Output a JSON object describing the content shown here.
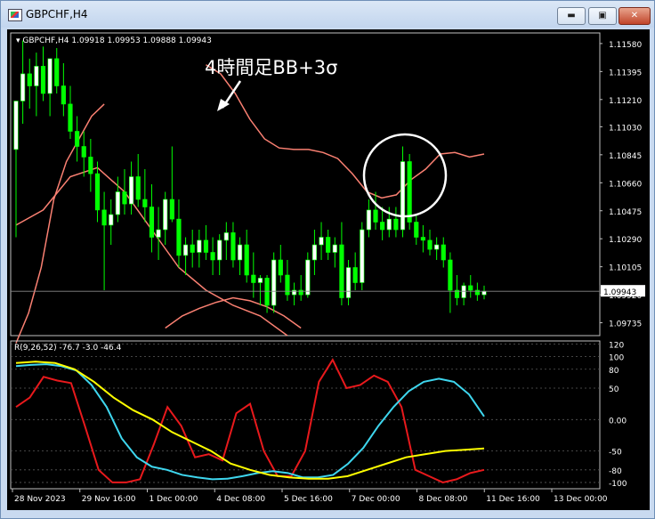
{
  "window": {
    "title": "GBPCHF,H4",
    "buttons": {
      "minimize": "▬",
      "maximize": "▣",
      "close": "✕"
    }
  },
  "colors": {
    "background": "#000000",
    "bull_candle": "#ffffff",
    "bear_candle": "#00ff00",
    "bollinger": "#fa8072",
    "rci_short": "#e8191c",
    "rci_mid": "#3ed6ee",
    "rci_long": "#ffff00",
    "annotation": "#ffffff"
  },
  "chart_data": [
    {
      "type": "candlestick",
      "title": "GBPCHF,H4 1.09918 1.09953 1.09888 1.09943",
      "annotation_text": "4時間足BB+3σ",
      "current_price": 1.09943,
      "current_price_label": "1.09943",
      "ylim": [
        1.0965,
        1.1165
      ],
      "ytick_labels": [
        "1.11580",
        "1.11395",
        "1.11210",
        "1.11030",
        "1.10845",
        "1.10660",
        "1.10475",
        "1.10290",
        "1.10105",
        "1.09920",
        "1.09735"
      ],
      "ytick_values": [
        1.1158,
        1.11395,
        1.1121,
        1.1103,
        1.10845,
        1.1066,
        1.10475,
        1.1029,
        1.10105,
        1.0992,
        1.09735
      ],
      "candles": [
        {
          "o": 1.1088,
          "h": 1.112,
          "l": 1.103,
          "c": 1.112
        },
        {
          "o": 1.112,
          "h": 1.116,
          "l": 1.1105,
          "c": 1.1138
        },
        {
          "o": 1.1138,
          "h": 1.1148,
          "l": 1.1115,
          "c": 1.113
        },
        {
          "o": 1.113,
          "h": 1.1152,
          "l": 1.111,
          "c": 1.1143
        },
        {
          "o": 1.1143,
          "h": 1.1156,
          "l": 1.112,
          "c": 1.1125
        },
        {
          "o": 1.1125,
          "h": 1.1148,
          "l": 1.111,
          "c": 1.1148
        },
        {
          "o": 1.1148,
          "h": 1.1155,
          "l": 1.1125,
          "c": 1.113
        },
        {
          "o": 1.113,
          "h": 1.1145,
          "l": 1.111,
          "c": 1.1118
        },
        {
          "o": 1.1118,
          "h": 1.113,
          "l": 1.1095,
          "c": 1.11
        },
        {
          "o": 1.11,
          "h": 1.111,
          "l": 1.108,
          "c": 1.109
        },
        {
          "o": 1.109,
          "h": 1.11,
          "l": 1.107,
          "c": 1.1083
        },
        {
          "o": 1.1083,
          "h": 1.1095,
          "l": 1.106,
          "c": 1.1072
        },
        {
          "o": 1.1072,
          "h": 1.108,
          "l": 1.104,
          "c": 1.1048
        },
        {
          "o": 1.1048,
          "h": 1.106,
          "l": 1.0995,
          "c": 1.1038
        },
        {
          "o": 1.1038,
          "h": 1.1055,
          "l": 1.1025,
          "c": 1.1045
        },
        {
          "o": 1.1045,
          "h": 1.107,
          "l": 1.104,
          "c": 1.106
        },
        {
          "o": 1.106,
          "h": 1.1075,
          "l": 1.1045,
          "c": 1.1052
        },
        {
          "o": 1.1052,
          "h": 1.108,
          "l": 1.1045,
          "c": 1.107
        },
        {
          "o": 1.107,
          "h": 1.1085,
          "l": 1.105,
          "c": 1.1055
        },
        {
          "o": 1.1055,
          "h": 1.1075,
          "l": 1.104,
          "c": 1.105
        },
        {
          "o": 1.105,
          "h": 1.1065,
          "l": 1.102,
          "c": 1.103
        },
        {
          "o": 1.103,
          "h": 1.105,
          "l": 1.1015,
          "c": 1.1035
        },
        {
          "o": 1.1035,
          "h": 1.106,
          "l": 1.1025,
          "c": 1.1055
        },
        {
          "o": 1.1055,
          "h": 1.109,
          "l": 1.104,
          "c": 1.1042
        },
        {
          "o": 1.1042,
          "h": 1.1055,
          "l": 1.101,
          "c": 1.1018
        },
        {
          "o": 1.1018,
          "h": 1.103,
          "l": 1.1005,
          "c": 1.1025
        },
        {
          "o": 1.1025,
          "h": 1.1035,
          "l": 1.101,
          "c": 1.102
        },
        {
          "o": 1.102,
          "h": 1.1035,
          "l": 1.101,
          "c": 1.1028
        },
        {
          "o": 1.1028,
          "h": 1.1038,
          "l": 1.1015,
          "c": 1.102
        },
        {
          "o": 1.102,
          "h": 1.103,
          "l": 1.1005,
          "c": 1.1015
        },
        {
          "o": 1.1015,
          "h": 1.1032,
          "l": 1.1005,
          "c": 1.1028
        },
        {
          "o": 1.1028,
          "h": 1.104,
          "l": 1.1015,
          "c": 1.1033
        },
        {
          "o": 1.1033,
          "h": 1.104,
          "l": 1.101,
          "c": 1.1015
        },
        {
          "o": 1.1015,
          "h": 1.103,
          "l": 1.1005,
          "c": 1.1025
        },
        {
          "o": 1.1025,
          "h": 1.1035,
          "l": 1.1,
          "c": 1.1005
        },
        {
          "o": 1.1005,
          "h": 1.102,
          "l": 1.099,
          "c": 1.1
        },
        {
          "o": 1.1,
          "h": 1.1005,
          "l": 1.0985,
          "c": 1.1003
        },
        {
          "o": 1.1003,
          "h": 1.1005,
          "l": 1.098,
          "c": 1.0985
        },
        {
          "o": 1.0985,
          "h": 1.102,
          "l": 1.098,
          "c": 1.1015
        },
        {
          "o": 1.1015,
          "h": 1.1025,
          "l": 1.1,
          "c": 1.1005
        },
        {
          "o": 1.1005,
          "h": 1.1015,
          "l": 1.0988,
          "c": 1.0992
        },
        {
          "o": 1.0992,
          "h": 1.1,
          "l": 1.0985,
          "c": 1.0995
        },
        {
          "o": 1.0995,
          "h": 1.1005,
          "l": 1.0988,
          "c": 1.0992
        },
        {
          "o": 1.0992,
          "h": 1.102,
          "l": 1.099,
          "c": 1.1015
        },
        {
          "o": 1.1015,
          "h": 1.1035,
          "l": 1.1005,
          "c": 1.1025
        },
        {
          "o": 1.1025,
          "h": 1.104,
          "l": 1.1015,
          "c": 1.103
        },
        {
          "o": 1.103,
          "h": 1.1035,
          "l": 1.1015,
          "c": 1.102
        },
        {
          "o": 1.102,
          "h": 1.103,
          "l": 1.101,
          "c": 1.1025
        },
        {
          "o": 1.1025,
          "h": 1.104,
          "l": 1.0985,
          "c": 1.099
        },
        {
          "o": 1.099,
          "h": 1.1015,
          "l": 1.0985,
          "c": 1.101
        },
        {
          "o": 1.101,
          "h": 1.102,
          "l": 1.0995,
          "c": 1.1
        },
        {
          "o": 1.1,
          "h": 1.104,
          "l": 1.0995,
          "c": 1.1035
        },
        {
          "o": 1.1035,
          "h": 1.1055,
          "l": 1.103,
          "c": 1.1048
        },
        {
          "o": 1.1048,
          "h": 1.106,
          "l": 1.1035,
          "c": 1.104
        },
        {
          "o": 1.104,
          "h": 1.105,
          "l": 1.1028,
          "c": 1.1035
        },
        {
          "o": 1.1035,
          "h": 1.105,
          "l": 1.103,
          "c": 1.1042
        },
        {
          "o": 1.1042,
          "h": 1.105,
          "l": 1.103,
          "c": 1.1035
        },
        {
          "o": 1.1035,
          "h": 1.109,
          "l": 1.103,
          "c": 1.108
        },
        {
          "o": 1.108,
          "h": 1.1085,
          "l": 1.1035,
          "c": 1.104
        },
        {
          "o": 1.104,
          "h": 1.1045,
          "l": 1.1025,
          "c": 1.103
        },
        {
          "o": 1.103,
          "h": 1.1038,
          "l": 1.102,
          "c": 1.1028
        },
        {
          "o": 1.1028,
          "h": 1.1035,
          "l": 1.1018,
          "c": 1.1022
        },
        {
          "o": 1.1022,
          "h": 1.103,
          "l": 1.1015,
          "c": 1.1025
        },
        {
          "o": 1.1025,
          "h": 1.103,
          "l": 1.101,
          "c": 1.1015
        },
        {
          "o": 1.1015,
          "h": 1.102,
          "l": 1.098,
          "c": 1.0995
        },
        {
          "o": 1.0995,
          "h": 1.1005,
          "l": 1.0985,
          "c": 1.099
        },
        {
          "o": 1.099,
          "h": 1.1,
          "l": 1.0985,
          "c": 1.0998
        },
        {
          "o": 1.0998,
          "h": 1.1005,
          "l": 1.099,
          "c": 1.0995
        },
        {
          "o": 1.0995,
          "h": 1.1,
          "l": 1.0988,
          "c": 1.0992
        },
        {
          "o": 1.0992,
          "h": 1.0998,
          "l": 1.0989,
          "c": 1.09943
        }
      ],
      "bb_upper": [
        1.096,
        1.098,
        1.101,
        1.1055,
        1.108,
        1.1095,
        1.111,
        1.1118,
        1.1112,
        1.1103,
        1.1092,
        1.1088,
        1.1088,
        1.1088,
        1.1086,
        1.108,
        1.1066,
        1.106,
        1.1056,
        1.106,
        1.107,
        1.1083,
        1.109,
        1.1086,
        1.108,
        1.1078
      ],
      "bb_upper_x": [
        0,
        2,
        4,
        6,
        8,
        10,
        12,
        14,
        16,
        18,
        20,
        22,
        24,
        26,
        28,
        30,
        32,
        34,
        36,
        38,
        40,
        42,
        44,
        46,
        48,
        50
      ],
      "bb_upper_display": [
        1.1144,
        1.1138,
        1.1125,
        1.1108,
        1.1095,
        1.1089,
        1.1088,
        1.1088,
        1.1086,
        1.1082,
        1.1072,
        1.106,
        1.1056,
        1.1058,
        1.1068,
        1.1075,
        1.1085,
        1.1086,
        1.1083,
        1.1085
      ],
      "bb_lower": [
        1.1038,
        1.1048,
        1.107,
        1.1076,
        1.106,
        1.1035,
        1.101,
        1.0995,
        1.0985,
        1.0978,
        1.0965
      ],
      "bb_lower_mid": [
        1.097,
        1.0978,
        1.0983,
        1.0987,
        1.099,
        1.0988,
        1.0984,
        1.0978,
        1.097
      ],
      "rci": {
        "label": "R(9,26,52) -76.7 -3.0 -46.4",
        "ylim": [
          -110,
          125
        ],
        "ytick_labels": [
          "120",
          "100",
          "80",
          "50",
          "0.00",
          "-50",
          "-80",
          "-100"
        ],
        "ytick_values": [
          120,
          100,
          80,
          50,
          0,
          -50,
          -80,
          -100
        ],
        "series": [
          {
            "values": [
              20,
              35,
              68,
              62,
              58,
              -10,
              -80,
              -100,
              -100,
              -95,
              -40,
              20,
              -10,
              -60,
              -55,
              -65,
              10,
              25,
              -50,
              -90,
              -90,
              -50,
              60,
              95,
              50,
              55,
              70,
              60,
              20,
              -80,
              -90,
              -100,
              -95,
              -85,
              -80
            ]
          },
          {
            "values": [
              85,
              87,
              88,
              85,
              78,
              55,
              20,
              -30,
              -60,
              -75,
              -80,
              -88,
              -92,
              -95,
              -94,
              -90,
              -85,
              -82,
              -85,
              -92,
              -92,
              -88,
              -70,
              -45,
              -10,
              20,
              45,
              60,
              65,
              60,
              40,
              5
            ]
          },
          {
            "values": [
              90,
              92,
              90,
              80,
              60,
              35,
              15,
              0,
              -20,
              -35,
              -50,
              -70,
              -80,
              -88,
              -92,
              -94,
              -94,
              -90,
              -80,
              -70,
              -60,
              -55,
              -50,
              -48,
              -46
            ]
          }
        ]
      },
      "x_labels": [
        "28 Nov 2023",
        "29 Nov 16:00",
        "1 Dec 00:00",
        "4 Dec 08:00",
        "5 Dec 16:00",
        "7 Dec 00:00",
        "8 Dec 08:00",
        "11 Dec 16:00",
        "13 Dec 00:00"
      ]
    }
  ]
}
